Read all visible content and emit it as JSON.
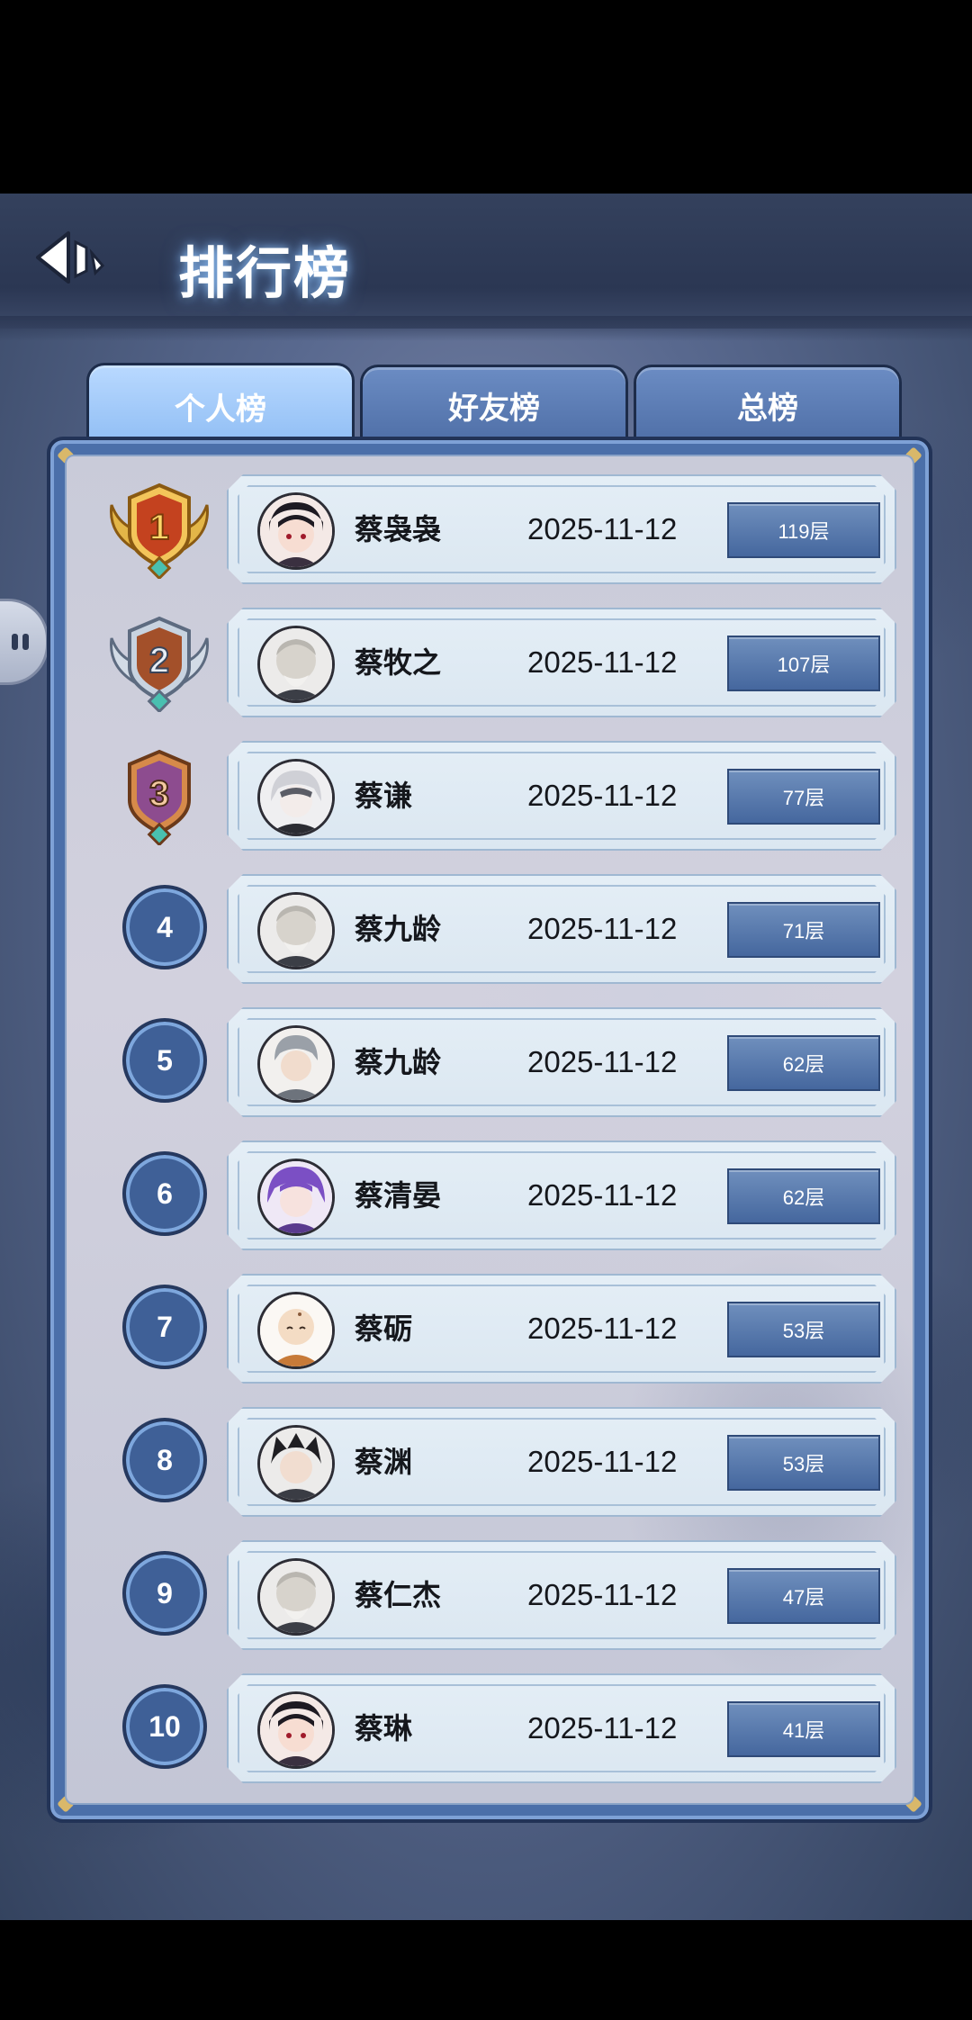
{
  "header": {
    "title": "排行榜",
    "back_icon": "back-arrow-icon"
  },
  "tabs": [
    {
      "label": "个人榜",
      "active": true
    },
    {
      "label": "好友榜",
      "active": false
    },
    {
      "label": "总榜",
      "active": false
    }
  ],
  "leaderboard": [
    {
      "rank": "1",
      "name": "蔡袅袅",
      "date": "2025-11-12",
      "floor": "119层",
      "badge": "gold-rank-badge-icon"
    },
    {
      "rank": "2",
      "name": "蔡牧之",
      "date": "2025-11-12",
      "floor": "107层",
      "badge": "silver-rank-badge-icon"
    },
    {
      "rank": "3",
      "name": "蔡谦",
      "date": "2025-11-12",
      "floor": "77层",
      "badge": "bronze-rank-badge-icon"
    },
    {
      "rank": "4",
      "name": "蔡九龄",
      "date": "2025-11-12",
      "floor": "71层"
    },
    {
      "rank": "5",
      "name": "蔡九龄",
      "date": "2025-11-12",
      "floor": "62层"
    },
    {
      "rank": "6",
      "name": "蔡清晏",
      "date": "2025-11-12",
      "floor": "62层"
    },
    {
      "rank": "7",
      "name": "蔡砺",
      "date": "2025-11-12",
      "floor": "53层"
    },
    {
      "rank": "8",
      "name": "蔡渊",
      "date": "2025-11-12",
      "floor": "53层"
    },
    {
      "rank": "9",
      "name": "蔡仁杰",
      "date": "2025-11-12",
      "floor": "47层"
    },
    {
      "rank": "10",
      "name": "蔡琳",
      "date": "2025-11-12",
      "floor": "41层"
    }
  ],
  "colors": {
    "panel_blue": "#4b6fa9",
    "tab_active": "#a9ceff",
    "gold": "#e7b84a",
    "silver": "#b8c3d3",
    "bronze": "#9a5aa0"
  }
}
